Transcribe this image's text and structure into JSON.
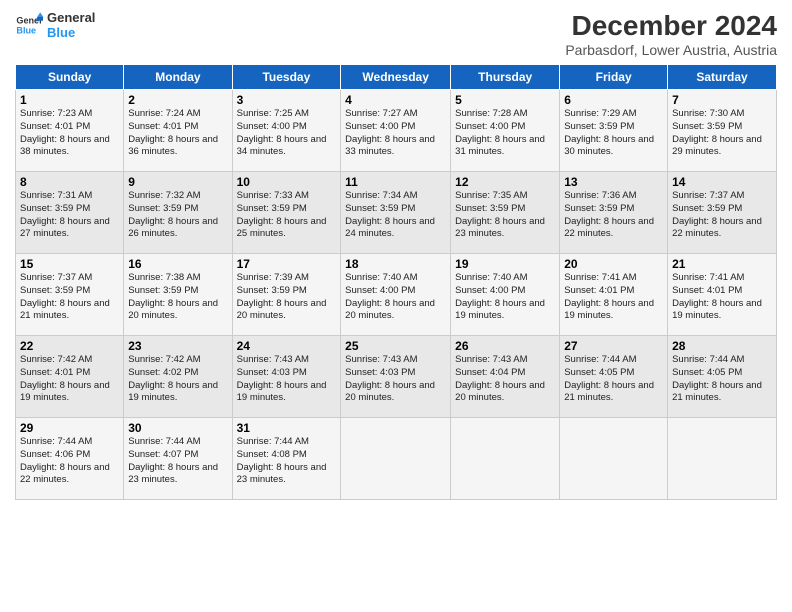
{
  "logo": {
    "line1": "General",
    "line2": "Blue"
  },
  "title": "December 2024",
  "subtitle": "Parbasdorf, Lower Austria, Austria",
  "weekdays": [
    "Sunday",
    "Monday",
    "Tuesday",
    "Wednesday",
    "Thursday",
    "Friday",
    "Saturday"
  ],
  "weeks": [
    [
      {
        "day": "1",
        "sunrise": "Sunrise: 7:23 AM",
        "sunset": "Sunset: 4:01 PM",
        "daylight": "Daylight: 8 hours and 38 minutes."
      },
      {
        "day": "2",
        "sunrise": "Sunrise: 7:24 AM",
        "sunset": "Sunset: 4:01 PM",
        "daylight": "Daylight: 8 hours and 36 minutes."
      },
      {
        "day": "3",
        "sunrise": "Sunrise: 7:25 AM",
        "sunset": "Sunset: 4:00 PM",
        "daylight": "Daylight: 8 hours and 34 minutes."
      },
      {
        "day": "4",
        "sunrise": "Sunrise: 7:27 AM",
        "sunset": "Sunset: 4:00 PM",
        "daylight": "Daylight: 8 hours and 33 minutes."
      },
      {
        "day": "5",
        "sunrise": "Sunrise: 7:28 AM",
        "sunset": "Sunset: 4:00 PM",
        "daylight": "Daylight: 8 hours and 31 minutes."
      },
      {
        "day": "6",
        "sunrise": "Sunrise: 7:29 AM",
        "sunset": "Sunset: 3:59 PM",
        "daylight": "Daylight: 8 hours and 30 minutes."
      },
      {
        "day": "7",
        "sunrise": "Sunrise: 7:30 AM",
        "sunset": "Sunset: 3:59 PM",
        "daylight": "Daylight: 8 hours and 29 minutes."
      }
    ],
    [
      {
        "day": "8",
        "sunrise": "Sunrise: 7:31 AM",
        "sunset": "Sunset: 3:59 PM",
        "daylight": "Daylight: 8 hours and 27 minutes."
      },
      {
        "day": "9",
        "sunrise": "Sunrise: 7:32 AM",
        "sunset": "Sunset: 3:59 PM",
        "daylight": "Daylight: 8 hours and 26 minutes."
      },
      {
        "day": "10",
        "sunrise": "Sunrise: 7:33 AM",
        "sunset": "Sunset: 3:59 PM",
        "daylight": "Daylight: 8 hours and 25 minutes."
      },
      {
        "day": "11",
        "sunrise": "Sunrise: 7:34 AM",
        "sunset": "Sunset: 3:59 PM",
        "daylight": "Daylight: 8 hours and 24 minutes."
      },
      {
        "day": "12",
        "sunrise": "Sunrise: 7:35 AM",
        "sunset": "Sunset: 3:59 PM",
        "daylight": "Daylight: 8 hours and 23 minutes."
      },
      {
        "day": "13",
        "sunrise": "Sunrise: 7:36 AM",
        "sunset": "Sunset: 3:59 PM",
        "daylight": "Daylight: 8 hours and 22 minutes."
      },
      {
        "day": "14",
        "sunrise": "Sunrise: 7:37 AM",
        "sunset": "Sunset: 3:59 PM",
        "daylight": "Daylight: 8 hours and 22 minutes."
      }
    ],
    [
      {
        "day": "15",
        "sunrise": "Sunrise: 7:37 AM",
        "sunset": "Sunset: 3:59 PM",
        "daylight": "Daylight: 8 hours and 21 minutes."
      },
      {
        "day": "16",
        "sunrise": "Sunrise: 7:38 AM",
        "sunset": "Sunset: 3:59 PM",
        "daylight": "Daylight: 8 hours and 20 minutes."
      },
      {
        "day": "17",
        "sunrise": "Sunrise: 7:39 AM",
        "sunset": "Sunset: 3:59 PM",
        "daylight": "Daylight: 8 hours and 20 minutes."
      },
      {
        "day": "18",
        "sunrise": "Sunrise: 7:40 AM",
        "sunset": "Sunset: 4:00 PM",
        "daylight": "Daylight: 8 hours and 20 minutes."
      },
      {
        "day": "19",
        "sunrise": "Sunrise: 7:40 AM",
        "sunset": "Sunset: 4:00 PM",
        "daylight": "Daylight: 8 hours and 19 minutes."
      },
      {
        "day": "20",
        "sunrise": "Sunrise: 7:41 AM",
        "sunset": "Sunset: 4:01 PM",
        "daylight": "Daylight: 8 hours and 19 minutes."
      },
      {
        "day": "21",
        "sunrise": "Sunrise: 7:41 AM",
        "sunset": "Sunset: 4:01 PM",
        "daylight": "Daylight: 8 hours and 19 minutes."
      }
    ],
    [
      {
        "day": "22",
        "sunrise": "Sunrise: 7:42 AM",
        "sunset": "Sunset: 4:01 PM",
        "daylight": "Daylight: 8 hours and 19 minutes."
      },
      {
        "day": "23",
        "sunrise": "Sunrise: 7:42 AM",
        "sunset": "Sunset: 4:02 PM",
        "daylight": "Daylight: 8 hours and 19 minutes."
      },
      {
        "day": "24",
        "sunrise": "Sunrise: 7:43 AM",
        "sunset": "Sunset: 4:03 PM",
        "daylight": "Daylight: 8 hours and 19 minutes."
      },
      {
        "day": "25",
        "sunrise": "Sunrise: 7:43 AM",
        "sunset": "Sunset: 4:03 PM",
        "daylight": "Daylight: 8 hours and 20 minutes."
      },
      {
        "day": "26",
        "sunrise": "Sunrise: 7:43 AM",
        "sunset": "Sunset: 4:04 PM",
        "daylight": "Daylight: 8 hours and 20 minutes."
      },
      {
        "day": "27",
        "sunrise": "Sunrise: 7:44 AM",
        "sunset": "Sunset: 4:05 PM",
        "daylight": "Daylight: 8 hours and 21 minutes."
      },
      {
        "day": "28",
        "sunrise": "Sunrise: 7:44 AM",
        "sunset": "Sunset: 4:05 PM",
        "daylight": "Daylight: 8 hours and 21 minutes."
      }
    ],
    [
      {
        "day": "29",
        "sunrise": "Sunrise: 7:44 AM",
        "sunset": "Sunset: 4:06 PM",
        "daylight": "Daylight: 8 hours and 22 minutes."
      },
      {
        "day": "30",
        "sunrise": "Sunrise: 7:44 AM",
        "sunset": "Sunset: 4:07 PM",
        "daylight": "Daylight: 8 hours and 23 minutes."
      },
      {
        "day": "31",
        "sunrise": "Sunrise: 7:44 AM",
        "sunset": "Sunset: 4:08 PM",
        "daylight": "Daylight: 8 hours and 23 minutes."
      },
      null,
      null,
      null,
      null
    ]
  ]
}
